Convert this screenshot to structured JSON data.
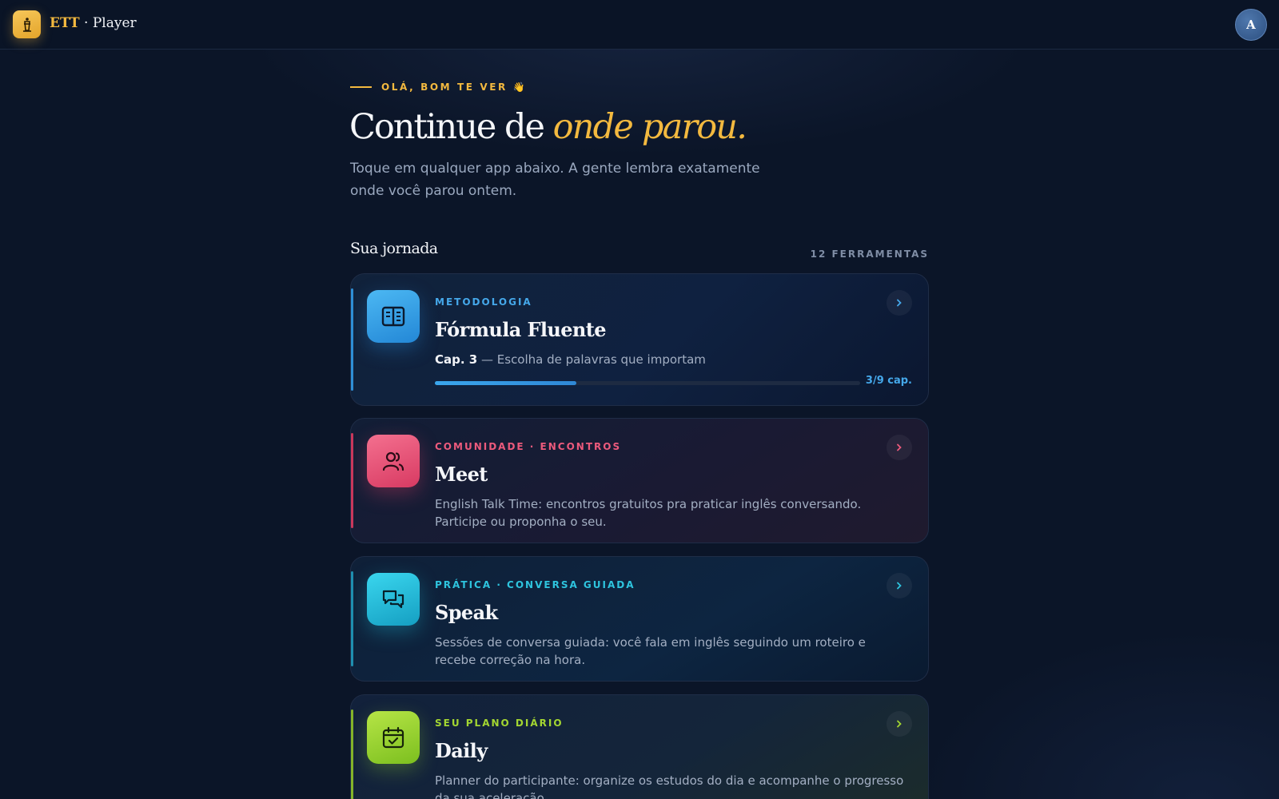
{
  "app": {
    "brand_name": "ETT",
    "brand_suffix": " · Player",
    "avatar_initial": "A"
  },
  "hero": {
    "greeting": "OLÁ, BOM TE VER 👋",
    "headline_main": "Continue de ",
    "headline_accent": "onde parou.",
    "subtext": "Toque em qualquer app abaixo. A gente lembra exatamente onde você parou ontem."
  },
  "section": {
    "title": "Sua jornada",
    "count": "12 FERRAMENTAS"
  },
  "cards": [
    {
      "kicker": "METODOLOGIA",
      "title": "Fórmula Fluente",
      "chapter": "Cap. 3",
      "desc": " — Escolha de palavras que importam",
      "progress_label": "3/9 cap.",
      "progress_fraction": 0.3333,
      "accent": "#3aa6ec",
      "icon": "book-icon"
    },
    {
      "kicker": "COMUNIDADE · ENCONTROS",
      "title": "Meet",
      "desc": "English Talk Time: encontros gratuitos pra praticar inglês conversando. Participe ou proponha o seu.",
      "accent": "#ec5a7c",
      "icon": "users-icon"
    },
    {
      "kicker": "PRÁTICA · CONVERSA GUIADA",
      "title": "Speak",
      "desc": "Sessões de conversa guiada: você fala em inglês seguindo um roteiro e recebe correção na hora.",
      "accent": "#2ec4de",
      "icon": "chat-icon"
    },
    {
      "kicker": "SEU PLANO DIÁRIO",
      "title": "Daily",
      "desc": "Planner do participante: organize os estudos do dia e acompanhe o progresso da sua aceleração.",
      "accent": "#a3d631",
      "icon": "calendar-check-icon"
    }
  ]
}
